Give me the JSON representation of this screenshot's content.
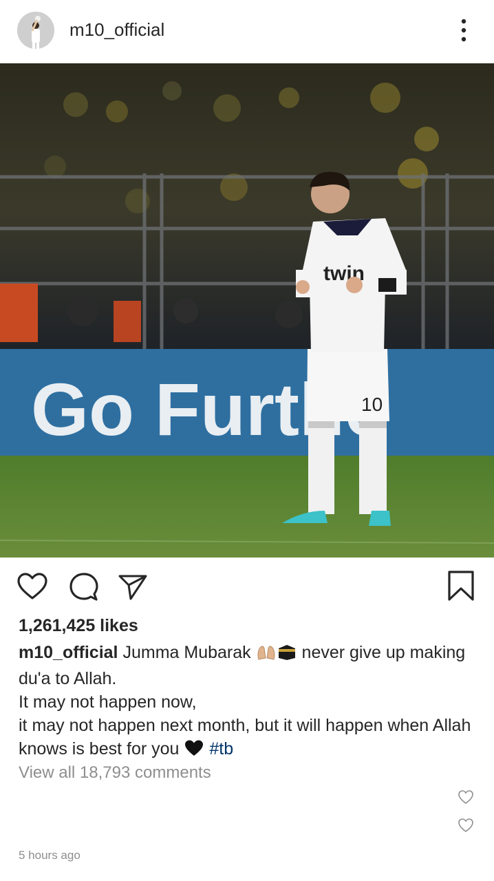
{
  "header": {
    "username": "m10_official",
    "more_icon": "more-vertical-icon"
  },
  "post": {
    "image_description_icon": "photo",
    "ad_board_text": "Go Furthe",
    "jersey_number": "10",
    "jersey_sponsor": "twin"
  },
  "actions": {
    "like_icon": "heart-icon",
    "comment_icon": "comment-icon",
    "share_icon": "send-icon",
    "save_icon": "bookmark-icon"
  },
  "likes_text": "1,261,425 likes",
  "caption": {
    "username": "m10_official",
    "line1_a": "Jumma Mubarak",
    "line1_b": "never give up making du'a to Allah.",
    "line2": "It may not happen now,",
    "line3": "it may not happen next month, but it will happen when Allah knows is best for you",
    "hashtag": "#tb"
  },
  "view_comments": "View all 18,793 comments",
  "timestamp": "5 hours ago",
  "colors": {
    "text": "#262626",
    "muted": "#8e8e8e",
    "hashtag": "#003569"
  }
}
